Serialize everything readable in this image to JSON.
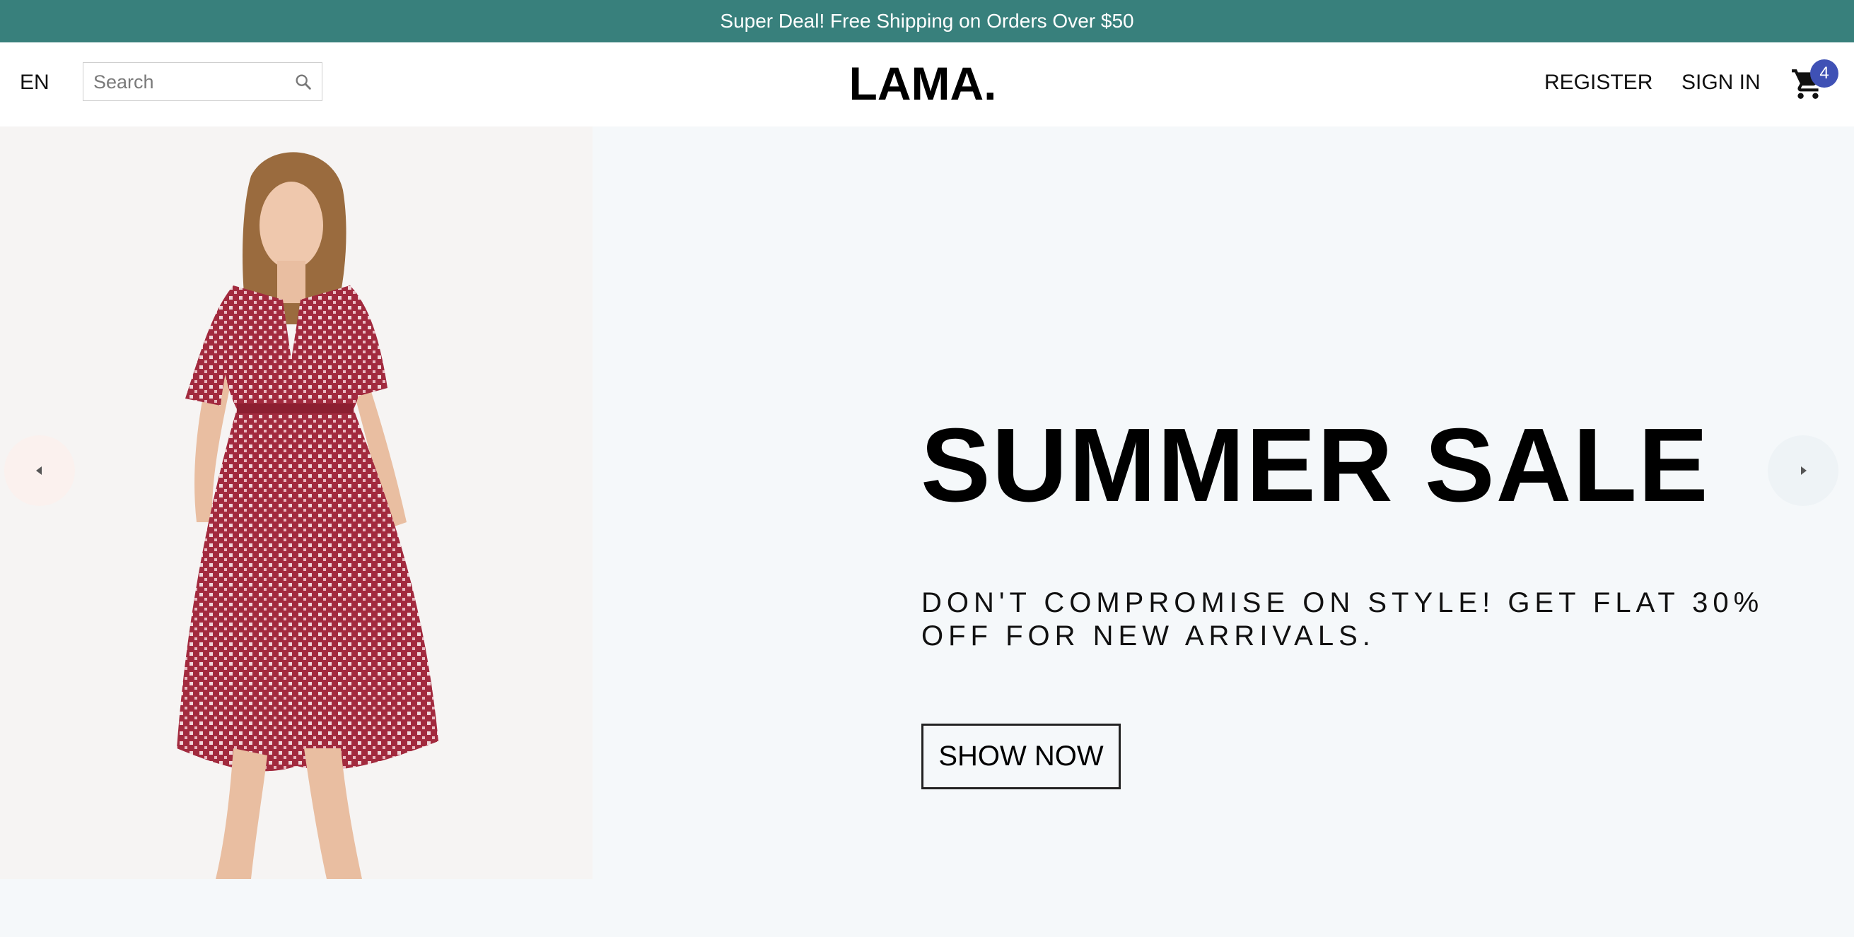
{
  "announcement": {
    "text": "Super Deal! Free Shipping on Orders Over $50"
  },
  "navbar": {
    "language": "EN",
    "search": {
      "placeholder": "Search",
      "value": ""
    },
    "logo": "LAMA.",
    "register_label": "REGISTER",
    "signin_label": "SIGN IN",
    "cart_count": "4"
  },
  "slide": {
    "title": "SUMMER SALE",
    "description": "DON'T COMPROMISE ON STYLE! GET FLAT 30% OFF FOR NEW ARRIVALS.",
    "button_label": "SHOW NOW"
  },
  "icons": {
    "search": "search-icon",
    "cart": "shopping-cart-icon",
    "left": "arrow-left-icon",
    "right": "arrow-right-icon"
  },
  "colors": {
    "announcement_bg": "#38807c",
    "badge_bg": "#3f51b5",
    "slide_bg": "#f5f8fa",
    "dress": "#a22a3e"
  }
}
